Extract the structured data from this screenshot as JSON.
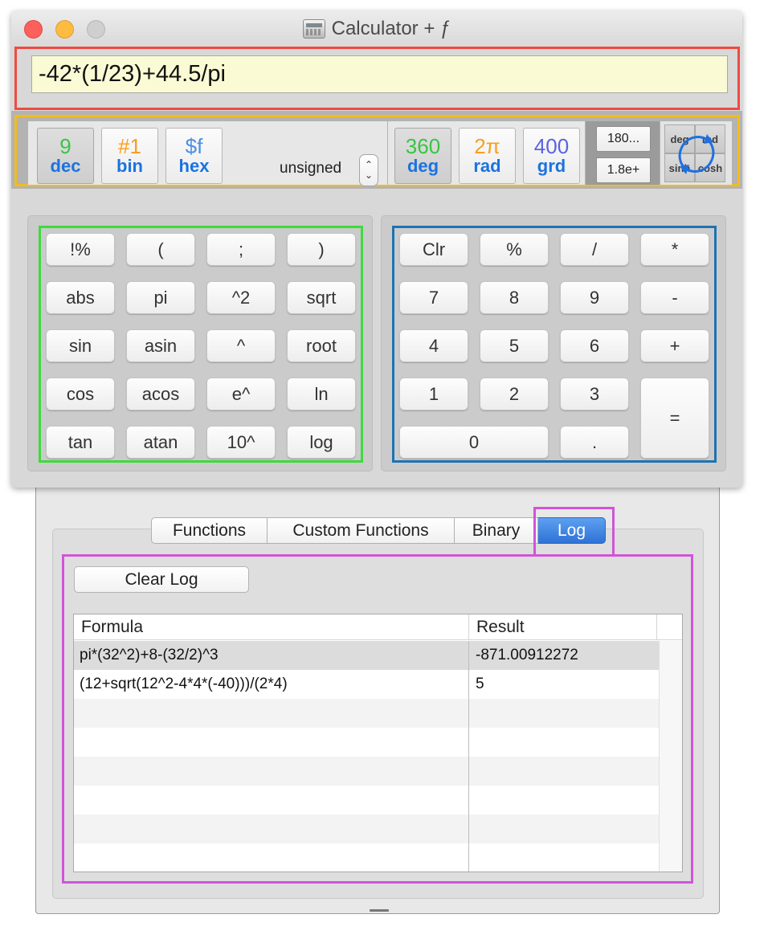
{
  "window": {
    "title": "Calculator + ƒ",
    "app_icon": "calculator-icon"
  },
  "display": {
    "expression": "-42*(1/23)+44.5/pi"
  },
  "number_base": {
    "buttons": [
      {
        "value": "9",
        "label": "dec",
        "color": "#38c543",
        "active": true
      },
      {
        "value": "#1",
        "label": "bin",
        "color": "#f99e1e",
        "active": false
      },
      {
        "value": "$f",
        "label": "hex",
        "color": "#4a8fe5",
        "active": false
      }
    ],
    "signedness": "unsigned"
  },
  "angle_mode": {
    "buttons": [
      {
        "value": "360",
        "label": "deg",
        "color": "#38c543",
        "active": true
      },
      {
        "value": "2π",
        "label": "rad",
        "color": "#f99e1e",
        "active": false
      },
      {
        "value": "400",
        "label": "grd",
        "color": "#5c62e0",
        "active": false
      }
    ]
  },
  "number_format": {
    "fixed": "180...",
    "scientific": "1.8e+"
  },
  "trig_toggle": {
    "deg": "deg",
    "rad": "rad",
    "sinh": "sinh",
    "cosh": "cosh"
  },
  "function_keys": [
    [
      "!%",
      "(",
      ";",
      ")"
    ],
    [
      "abs",
      "pi",
      "^2",
      "sqrt"
    ],
    [
      "sin",
      "asin",
      "^",
      "root"
    ],
    [
      "cos",
      "acos",
      "e^",
      "ln"
    ],
    [
      "tan",
      "atan",
      "10^",
      "log"
    ]
  ],
  "numeric_keys": {
    "row1": [
      "Clr",
      "%",
      "/",
      "*"
    ],
    "row2": [
      "7",
      "8",
      "9",
      "-"
    ],
    "row3": [
      "4",
      "5",
      "6",
      "+"
    ],
    "row4": [
      "1",
      "2",
      "3"
    ],
    "zero": "0",
    "dot": ".",
    "equals": "="
  },
  "tabs": [
    "Functions",
    "Custom Functions",
    "Binary",
    "Log"
  ],
  "active_tab": "Log",
  "log": {
    "clear_button": "Clear Log",
    "columns": [
      "Formula",
      "Result"
    ],
    "rows": [
      {
        "formula": "pi*(32^2)+8-(32/2)^3",
        "result": "-871.00912272"
      },
      {
        "formula": "(12+sqrt(12^2-4*4*(-40)))/(2*4)",
        "result": "5"
      }
    ]
  },
  "colors": {
    "display_highlight": "#ee4b41",
    "mode_highlight": "#f3bc1c",
    "function_pad_highlight": "#3ddb3d",
    "numeric_pad_highlight": "#1e73b1",
    "log_highlight": "#d154d9",
    "display_background": "#fafad4"
  }
}
